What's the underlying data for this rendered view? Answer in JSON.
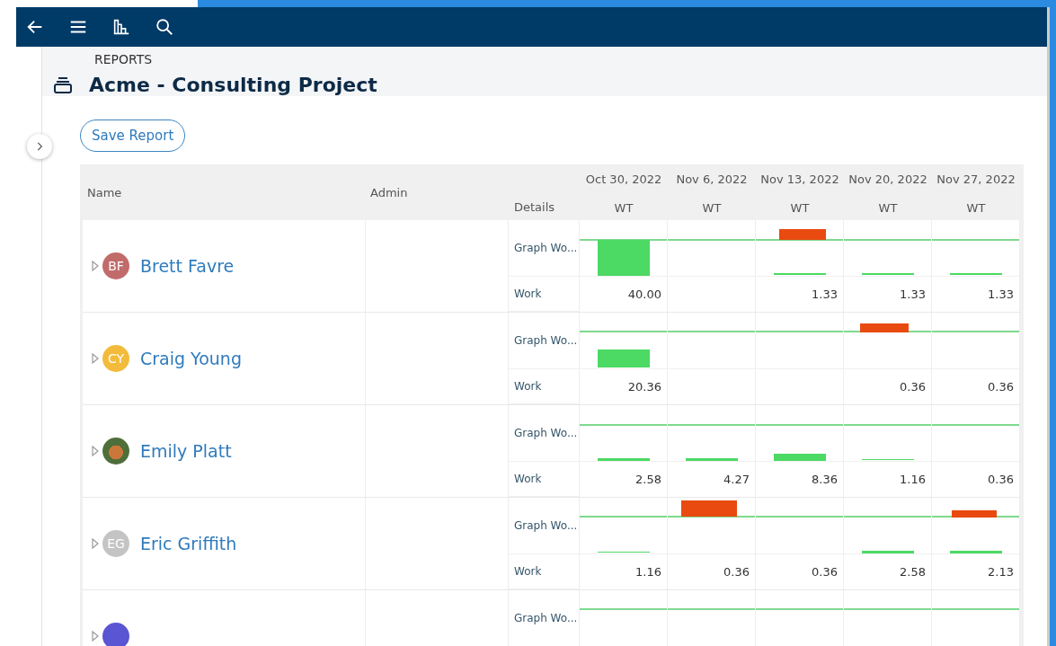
{
  "breadcrumb": "REPORTS",
  "title": "Acme - Consulting Project",
  "save_button": "Save Report",
  "table": {
    "columns": {
      "name": "Name",
      "admin": "Admin",
      "details": "Details"
    },
    "periods": [
      {
        "date": "Oct 30, 2022",
        "metric": "WT"
      },
      {
        "date": "Nov 6, 2022",
        "metric": "WT"
      },
      {
        "date": "Nov 13, 2022",
        "metric": "WT"
      },
      {
        "date": "Nov 20, 2022",
        "metric": "WT"
      },
      {
        "date": "Nov 27, 2022",
        "metric": "WT"
      }
    ],
    "rows": [
      {
        "name": "Brett Favre",
        "avatar": {
          "kind": "initials",
          "initials": "BF",
          "color": "#c26b6b"
        },
        "graph_label": "Graph Wo...",
        "work_label": "Work",
        "work": {
          "period_1": "40.00",
          "period_3": "1.33",
          "period_4": "1.33",
          "period_5": "1.33"
        }
      },
      {
        "name": "Craig Young",
        "avatar": {
          "kind": "initials",
          "initials": "CY",
          "color": "#f2bb3c"
        },
        "graph_label": "Graph Wo...",
        "work_label": "Work",
        "work": {
          "period_1": "20.36",
          "period_4": "0.36",
          "period_5": "0.36"
        }
      },
      {
        "name": "Emily Platt",
        "avatar": {
          "kind": "photo"
        },
        "graph_label": "Graph Wo...",
        "work_label": "Work",
        "work": {
          "period_1": "2.58",
          "period_2": "4.27",
          "period_3": "8.36",
          "period_4": "1.16",
          "period_5": "0.36"
        }
      },
      {
        "name": "Eric Griffith",
        "avatar": {
          "kind": "initials",
          "initials": "EG",
          "color": "#c4c4c4"
        },
        "graph_label": "Graph Wo...",
        "work_label": "Work",
        "work": {
          "period_1": "1.16",
          "period_2": "0.36",
          "period_3": "0.36",
          "period_4": "2.58",
          "period_5": "2.13"
        }
      },
      {
        "avatar": {
          "kind": "blank",
          "color": "#5a55d2"
        },
        "graph_label": "Graph Wo..."
      }
    ]
  }
}
